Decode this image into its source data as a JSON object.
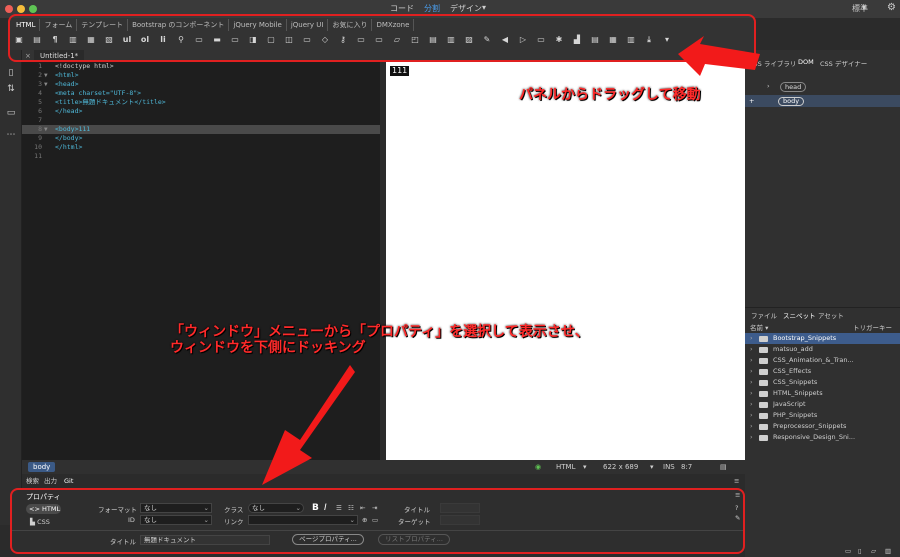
{
  "titlebar": {
    "modes": [
      "コード",
      "分割",
      "デザイン"
    ],
    "active_mode": "分割",
    "workspace": "標準"
  },
  "insert_panel": {
    "tabs": [
      "HTML",
      "フォーム",
      "テンプレート",
      "Bootstrap のコンポーネント",
      "jQuery Mobile",
      "jQuery UI",
      "お気に入り",
      "DMXzone"
    ],
    "active_tab": "HTML",
    "icon_labels": [
      "ul",
      "ol",
      "li"
    ]
  },
  "document": {
    "tab_label": "Untitled-1*",
    "close_label": "×"
  },
  "code_lines": [
    {
      "n": "1",
      "text": "<!doctype html>"
    },
    {
      "n": "2",
      "text": "<html>"
    },
    {
      "n": "3",
      "text": "<head>"
    },
    {
      "n": "4",
      "text": "<meta charset=\"UTF-8\">"
    },
    {
      "n": "5",
      "text": "<title>無題ドキュメント</title>"
    },
    {
      "n": "6",
      "text": "</head>"
    },
    {
      "n": "7",
      "text": ""
    },
    {
      "n": "8",
      "text": "<body>111"
    },
    {
      "n": "9",
      "text": "</body>"
    },
    {
      "n": "10",
      "text": "</html>"
    },
    {
      "n": "11",
      "text": ""
    }
  ],
  "design_view": {
    "text": "111"
  },
  "status_bar": {
    "tag": "body",
    "language": "HTML",
    "size": "622 x 689",
    "ins": "INS",
    "position": "8:7"
  },
  "bottom_tabs": [
    "検索",
    "出力",
    "Git"
  ],
  "properties": {
    "title": "プロパティ",
    "html_btn": "HTML",
    "css_btn": "CSS",
    "format_label": "フォーマット",
    "format_value": "なし",
    "id_label": "ID",
    "id_value": "なし",
    "class_label": "クラス",
    "class_value": "なし",
    "link_label": "リンク",
    "link_value": "",
    "title_attr_label": "タイトル",
    "target_label": "ターゲット",
    "doc_title_label": "タイトル",
    "doc_title_value": "無題ドキュメント",
    "page_props_btn": "ページプロパティ...",
    "list_props_btn": "リストプロパティ..."
  },
  "right_panel": {
    "top_tabs": [
      "CSS ライブラリ",
      "DOM",
      "CSS デザイナー"
    ],
    "active_top_tab": "DOM",
    "dom_head": "head",
    "dom_body": "body",
    "file_tabs": [
      "ファイル",
      "スニペット",
      "アセット"
    ],
    "active_file_tab": "スニペット",
    "col_name": "名前 ▾",
    "col_trigger": "トリガーキー",
    "snippets": [
      "Bootstrap_Snippets",
      "matsuo_add",
      "CSS_Animation_&_Tran...",
      "CSS_Effects",
      "CSS_Snippets",
      "HTML_Snippets",
      "JavaScript",
      "PHP_Snippets",
      "Preprocessor_Snippets",
      "Responsive_Design_Sni..."
    ]
  },
  "annotations": {
    "drag": "パネルからドラッグして移動",
    "window_line1": "「ウィンドウ」メニューから「プロパティ」を選択して表示させ、",
    "window_line2": "ウィンドウを下側にドッキング"
  },
  "colors": {
    "annotation_red": "#ff2a2a",
    "selection_blue": "#3d5c8c",
    "tag_blue": "#4fb8d8"
  }
}
